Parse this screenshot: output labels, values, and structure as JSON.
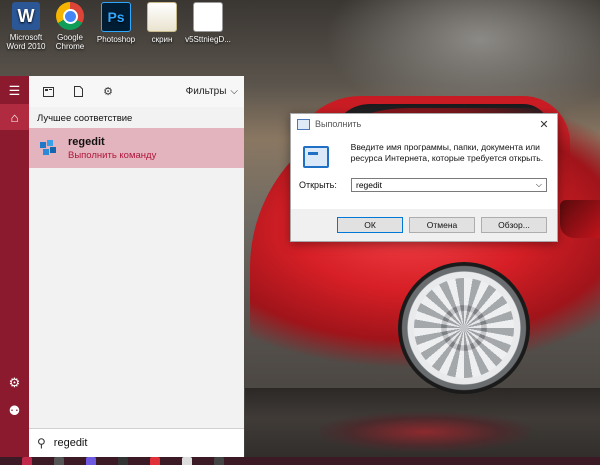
{
  "desktop": {
    "icons": [
      {
        "label": "Microsoft Word 2010",
        "icon": "word-icon",
        "glyph": "W"
      },
      {
        "label": "Google Chrome",
        "icon": "chrome-icon",
        "glyph": ""
      },
      {
        "label": "Photoshop",
        "icon": "photoshop-icon",
        "glyph": "Ps"
      },
      {
        "label": "скрин",
        "icon": "folder-icon",
        "glyph": ""
      },
      {
        "label": "v5SttniegD...",
        "icon": "document-icon",
        "glyph": ""
      }
    ]
  },
  "start_menu": {
    "filters_label": "Фильтры",
    "best_match_heading": "Лучшее соответствие",
    "best_match": {
      "title": "regedit",
      "subtitle": "Выполнить команду",
      "icon": "regedit-icon"
    },
    "search": {
      "value": "regedit"
    }
  },
  "run_dialog": {
    "title": "Выполнить",
    "description": "Введите имя программы, папки, документа или ресурса Интернета, которые требуется открыть.",
    "open_label": "Открыть:",
    "open_value": "regedit",
    "buttons": {
      "ok": "ОК",
      "cancel": "Отмена",
      "browse": "Обзор..."
    }
  },
  "colors": {
    "accent": "#8b1a2e",
    "highlight": "#e3b4bd",
    "subtitle": "#b0163d"
  }
}
